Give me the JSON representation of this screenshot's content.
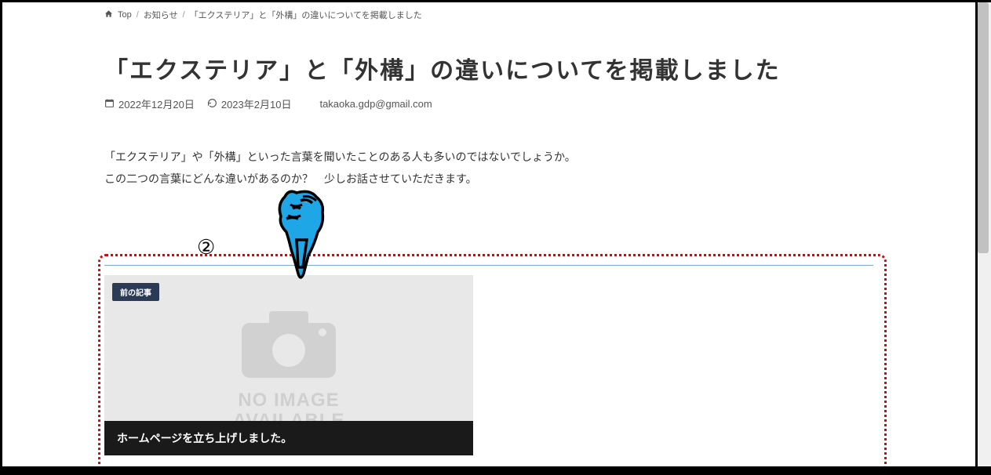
{
  "breadcrumb": {
    "home": "Top",
    "cat": "お知らせ",
    "current": "「エクステリア」と「外構」の違いについてを掲載しました"
  },
  "title": "「エクステリア」と「外構」の違いについてを掲載しました",
  "meta": {
    "published": "2022年12月20日",
    "updated": "2023年2月10日",
    "author": "takaoka.gdp@gmail.com"
  },
  "body": {
    "line1": "「エクステリア」や「外構」といった言葉を聞いたことのある人も多いのではないでしょうか。",
    "line2": "この二つの言葉にどんな違いがあるのか？　少しお話させていただきます。"
  },
  "annotation": {
    "number": "②"
  },
  "prev": {
    "badge": "前の記事",
    "noimg1": "NO IMAGE",
    "noimg2": "AVAILABLE",
    "title": "ホームページを立ち上げしました。"
  }
}
